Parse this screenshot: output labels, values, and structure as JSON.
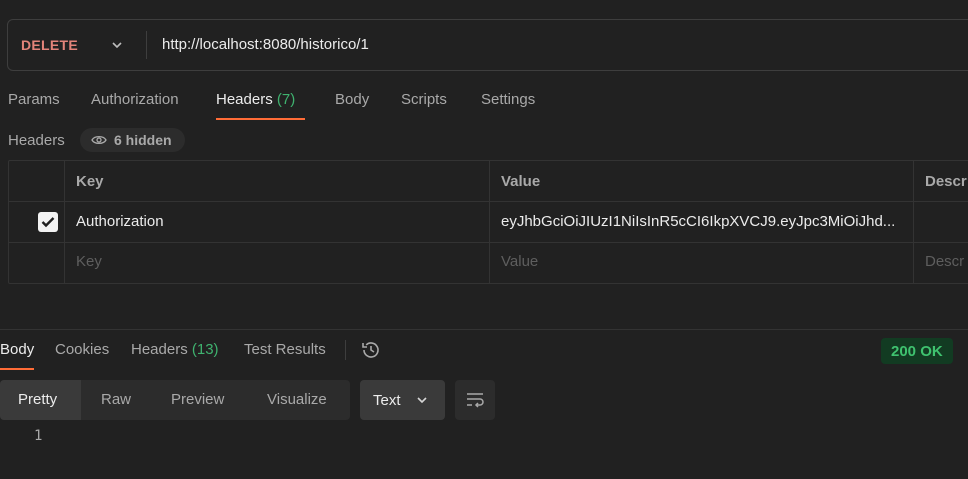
{
  "request": {
    "method": "DELETE",
    "url": "http://localhost:8080/historico/1"
  },
  "request_tabs": [
    {
      "label": "Params"
    },
    {
      "label": "Authorization"
    },
    {
      "label": "Headers",
      "count": "(7)"
    },
    {
      "label": "Body"
    },
    {
      "label": "Scripts"
    },
    {
      "label": "Settings"
    }
  ],
  "headers_section": {
    "label": "Headers",
    "hidden": "6 hidden",
    "columns": [
      "Key",
      "Value",
      "Descr"
    ],
    "rows": [
      {
        "checked": true,
        "key": "Authorization",
        "value": "eyJhbGciOiJIUzI1NiIsInR5cCI6IkpXVCJ9.eyJpc3MiOiJhd..."
      }
    ],
    "placeholder": {
      "key": "Key",
      "value": "Value",
      "description": "Descr"
    }
  },
  "response_tabs": [
    {
      "label": "Body"
    },
    {
      "label": "Cookies"
    },
    {
      "label": "Headers",
      "count": "(13)"
    },
    {
      "label": "Test Results"
    }
  ],
  "status": "200 OK",
  "view_modes": [
    "Pretty",
    "Raw",
    "Preview",
    "Visualize"
  ],
  "format": "Text",
  "line_numbers": [
    "1"
  ],
  "colors": {
    "method": "#e3847a",
    "accent": "#ff6c37",
    "count": "#3fb26f",
    "status_bg": "#123b22",
    "status_text": "#3fc26f"
  }
}
